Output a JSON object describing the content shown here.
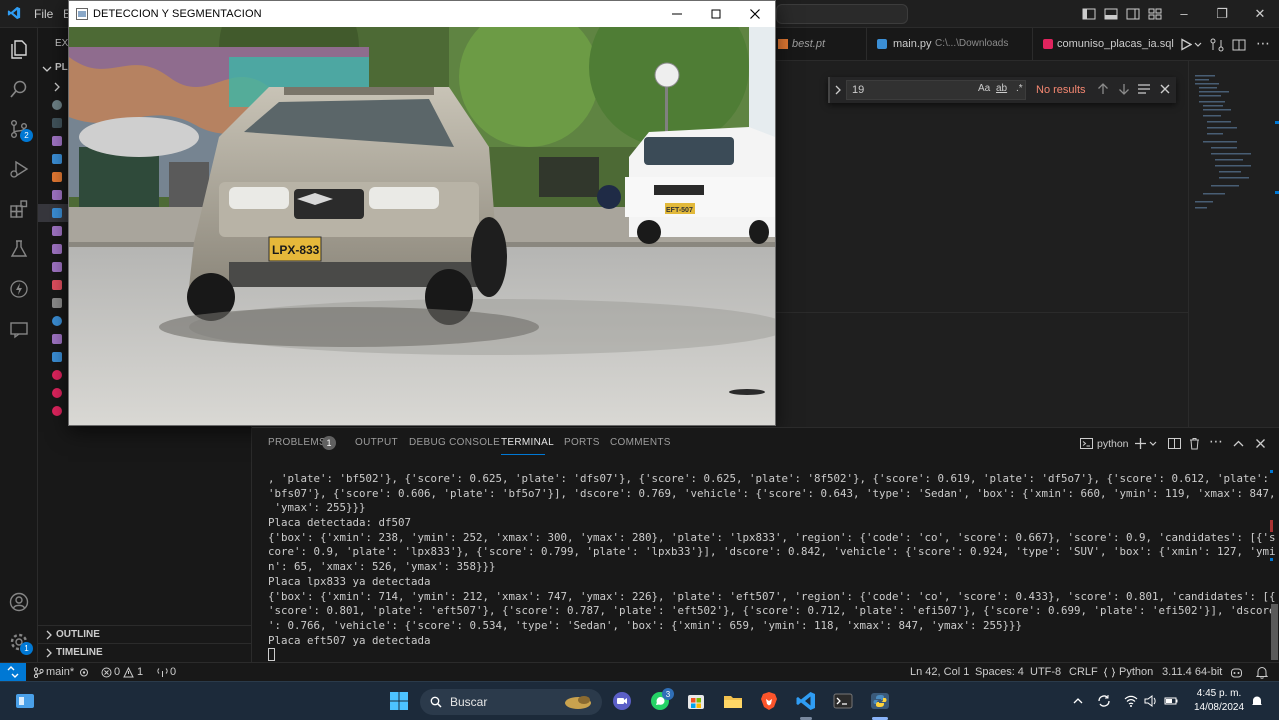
{
  "titlebar": {
    "menu": [
      "File",
      "E"
    ]
  },
  "video_window": {
    "title": "DETECCION Y SEGMENTACION",
    "plates": [
      "LPX-833",
      "EFT-507"
    ]
  },
  "activity": {
    "scm_badge": "2",
    "settings_badge": "1"
  },
  "sidebar": {
    "header": "EXP",
    "folder": "PLA",
    "outline": "OUTLINE",
    "timeline": "TIMELINE"
  },
  "tabs": [
    {
      "label": "best.pt",
      "detail": ""
    },
    {
      "label": "main.py",
      "detail": "C:\\...\\Downloads"
    },
    {
      "label": "comuniso_placas_ia.sql",
      "detail": ""
    }
  ],
  "find": {
    "value": "19",
    "opt_case": "Aa",
    "opt_word": "ab",
    "opt_regex": ".*",
    "result": "No results"
  },
  "panel": {
    "tabs": [
      "PROBLEMS",
      "OUTPUT",
      "DEBUG CONSOLE",
      "TERMINAL",
      "PORTS",
      "COMMENTS"
    ],
    "problems_count": "1",
    "shell": "python",
    "terminal_lines": [
      ", 'plate': 'bf502'}, {'score': 0.625, 'plate': 'dfs07'}, {'score': 0.625, 'plate': '8f502'}, {'score': 0.619, 'plate': 'df5o7'}, {'score': 0.612, 'plate':",
      "'bfs07'}, {'score': 0.606, 'plate': 'bf5o7'}], 'dscore': 0.769, 'vehicle': {'score': 0.643, 'type': 'Sedan', 'box': {'xmin': 660, 'ymin': 119, 'xmax': 847,",
      " 'ymax': 255}}}",
      "Placa detectada: df507",
      "{'box': {'xmin': 238, 'ymin': 252, 'xmax': 300, 'ymax': 280}, 'plate': 'lpx833', 'region': {'code': 'co', 'score': 0.667}, 'score': 0.9, 'candidates': [{'s",
      "core': 0.9, 'plate': 'lpx833'}, {'score': 0.799, 'plate': 'lpxb33'}], 'dscore': 0.842, 'vehicle': {'score': 0.924, 'type': 'SUV', 'box': {'xmin': 127, 'ymi",
      "n': 65, 'xmax': 526, 'ymax': 358}}}",
      "Placa lpx833 ya detectada",
      "{'box': {'xmin': 714, 'ymin': 212, 'xmax': 747, 'ymax': 226}, 'plate': 'eft507', 'region': {'code': 'co', 'score': 0.433}, 'score': 0.801, 'candidates': [{",
      "'score': 0.801, 'plate': 'eft507'}, {'score': 0.787, 'plate': 'eft502'}, {'score': 0.712, 'plate': 'efi507'}, {'score': 0.699, 'plate': 'efi502'}], 'dscore",
      "': 0.766, 'vehicle': {'score': 0.534, 'type': 'Sedan', 'box': {'xmin': 659, 'ymin': 118, 'xmax': 847, 'ymax': 255}}}",
      "Placa eft507 ya detectada"
    ]
  },
  "status": {
    "branch": "main*",
    "errors": "0",
    "warnings": "1",
    "ports": "0",
    "position": "Ln 42, Col 1",
    "spaces": "Spaces: 4",
    "encoding": "UTF-8",
    "eol": "CRLF",
    "language": "Python",
    "interpreter": "3.11.4 64-bit"
  },
  "taskbar": {
    "search_placeholder": "Buscar",
    "whatsapp_badge": "3",
    "time": "4:45 p. m.",
    "date": "14/08/2024"
  },
  "colors": {
    "accent": "#0078d4",
    "no_results": "#f48771",
    "terminal_text": "#cccccc"
  }
}
